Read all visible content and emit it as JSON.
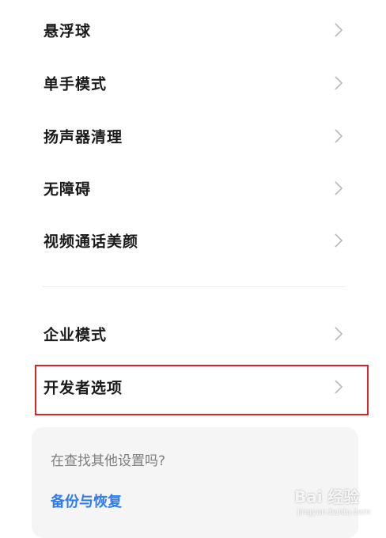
{
  "settings_group_1": [
    {
      "label": "悬浮球"
    },
    {
      "label": "单手模式"
    },
    {
      "label": "扬声器清理"
    },
    {
      "label": "无障碍"
    },
    {
      "label": "视频通话美颜"
    }
  ],
  "settings_group_2": [
    {
      "label": "企业模式"
    },
    {
      "label": "开发者选项"
    }
  ],
  "suggestions": {
    "question": "在查找其他设置吗?",
    "link": "备份与恢复"
  },
  "watermark": {
    "brand": "Bai 经验",
    "url": "jingyan.baidu.com"
  },
  "colors": {
    "highlight_border": "#d8252c",
    "link": "#2d7cf0",
    "chevron": "#b8b8b8"
  }
}
